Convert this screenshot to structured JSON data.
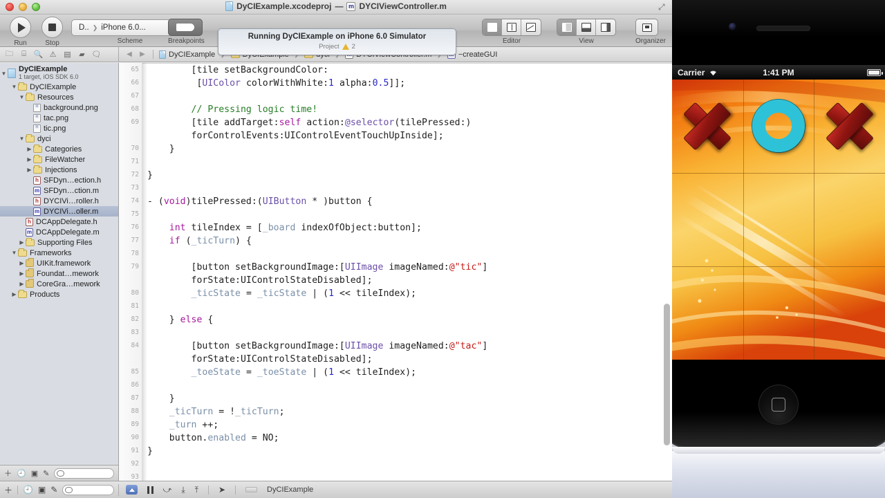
{
  "window": {
    "title_project": "DyCIExample.xcodeproj",
    "title_sep": "—",
    "title_file": "DYCIViewController.m",
    "m_badge": "m"
  },
  "toolbar": {
    "run_label": "Run",
    "stop_label": "Stop",
    "scheme_label": "Scheme",
    "scheme_target": "D..",
    "scheme_device": "iPhone 6.0...",
    "breakpoints_label": "Breakpoints",
    "activity_main": "Running DyCIExample on iPhone 6.0 Simulator",
    "activity_sub": "Project",
    "warning_count": "2",
    "editor_label": "Editor",
    "view_label": "View",
    "organizer_label": "Organizer"
  },
  "jumpbar": {
    "back": "◀",
    "forward": "▶",
    "crumbs": [
      {
        "label": "DyCIExample",
        "icon": "project-icon"
      },
      {
        "label": "DyCIExample",
        "icon": "folder-icon"
      },
      {
        "label": "dyci",
        "icon": "folder-icon"
      },
      {
        "label": "DYCIViewController.m",
        "icon": "m-file-icon"
      },
      {
        "label": "−createGUI",
        "icon": "method-icon"
      }
    ]
  },
  "navigator": {
    "selector_icons": [
      "folder-icon",
      "hierarchy-icon",
      "search-icon",
      "warning-icon",
      "test-icon",
      "breakpoint-icon",
      "log-icon",
      "grid-icon"
    ],
    "project": {
      "name": "DyCIExample",
      "subtitle": "1 target, iOS SDK 6.0"
    },
    "items": [
      {
        "label": "DyCIExample",
        "icon": "folder-icon",
        "indent": 1,
        "disc": "open"
      },
      {
        "label": "Resources",
        "icon": "folder-icon",
        "indent": 2,
        "disc": "open"
      },
      {
        "label": "background.png",
        "icon": "image-icon",
        "indent": 3,
        "disc": "none"
      },
      {
        "label": "tac.png",
        "icon": "image-icon",
        "indent": 3,
        "disc": "none"
      },
      {
        "label": "tic.png",
        "icon": "image-icon",
        "indent": 3,
        "disc": "none"
      },
      {
        "label": "dyci",
        "icon": "folder-icon",
        "indent": 2,
        "disc": "open"
      },
      {
        "label": "Categories",
        "icon": "folder-icon",
        "indent": 3,
        "disc": "closed"
      },
      {
        "label": "FileWatcher",
        "icon": "folder-icon",
        "indent": 3,
        "disc": "closed"
      },
      {
        "label": "Injections",
        "icon": "folder-icon",
        "indent": 3,
        "disc": "closed"
      },
      {
        "label": "SFDyn…ection.h",
        "icon": "h-file-icon",
        "indent": 3,
        "disc": "none"
      },
      {
        "label": "SFDyn…ction.m",
        "icon": "m-file-icon",
        "indent": 3,
        "disc": "none"
      },
      {
        "label": "DYCIVi…roller.h",
        "icon": "h-file-icon",
        "indent": 3,
        "disc": "none"
      },
      {
        "label": "DYCIVi…oller.m",
        "icon": "m-file-icon",
        "indent": 3,
        "disc": "none",
        "selected": true
      },
      {
        "label": "DCAppDelegate.h",
        "icon": "h-file-icon",
        "indent": 2,
        "disc": "none"
      },
      {
        "label": "DCAppDelegate.m",
        "icon": "m-file-icon",
        "indent": 2,
        "disc": "none"
      },
      {
        "label": "Supporting Files",
        "icon": "folder-icon",
        "indent": 2,
        "disc": "closed"
      },
      {
        "label": "Frameworks",
        "icon": "folder-icon",
        "indent": 1,
        "disc": "open"
      },
      {
        "label": "UIKit.framework",
        "icon": "framework-icon",
        "indent": 2,
        "disc": "closed"
      },
      {
        "label": "Foundat…mework",
        "icon": "framework-icon",
        "indent": 2,
        "disc": "closed"
      },
      {
        "label": "CoreGra…mework",
        "icon": "framework-icon",
        "indent": 2,
        "disc": "closed"
      },
      {
        "label": "Products",
        "icon": "folder-icon",
        "indent": 1,
        "disc": "closed"
      }
    ],
    "filter_placeholder": ""
  },
  "editor": {
    "first_line": 65,
    "lines": [
      {
        "n": 65,
        "indent": 4,
        "tokens": [
          {
            "t": "[tile setBackgroundColor:",
            "c": ""
          }
        ]
      },
      {
        "n": 66,
        "indent": 4.5,
        "tokens": [
          {
            "t": "[",
            "c": ""
          },
          {
            "t": "UIColor",
            "c": "cls"
          },
          {
            "t": " colorWithWhite:",
            "c": ""
          },
          {
            "t": "1",
            "c": "num"
          },
          {
            "t": " alpha:",
            "c": ""
          },
          {
            "t": "0.5",
            "c": "num"
          },
          {
            "t": "]];",
            "c": ""
          }
        ]
      },
      {
        "n": 67,
        "indent": 0,
        "tokens": []
      },
      {
        "n": 68,
        "indent": 4,
        "tokens": [
          {
            "t": "// Pressing logic time!",
            "c": "cmt"
          }
        ]
      },
      {
        "n": 69,
        "indent": 4,
        "tokens": [
          {
            "t": "[tile addTarget:",
            "c": ""
          },
          {
            "t": "self",
            "c": "kw"
          },
          {
            "t": " action:",
            "c": ""
          },
          {
            "t": "@selector",
            "c": "pre"
          },
          {
            "t": "(tilePressed:)",
            "c": ""
          }
        ]
      },
      {
        "n": null,
        "indent": 4,
        "tokens": [
          {
            "t": "forControlEvents:UIControlEventTouchUpInside];",
            "c": ""
          }
        ]
      },
      {
        "n": 70,
        "indent": 2,
        "tokens": [
          {
            "t": "}",
            "c": ""
          }
        ]
      },
      {
        "n": 71,
        "indent": 0,
        "tokens": []
      },
      {
        "n": 72,
        "indent": 0,
        "tokens": [
          {
            "t": "}",
            "c": ""
          }
        ]
      },
      {
        "n": 73,
        "indent": 0,
        "tokens": []
      },
      {
        "n": 74,
        "indent": 0,
        "tokens": [
          {
            "t": "- (",
            "c": ""
          },
          {
            "t": "void",
            "c": "kw"
          },
          {
            "t": ")tilePressed:(",
            "c": ""
          },
          {
            "t": "UIButton",
            "c": "cls"
          },
          {
            "t": " * )button {",
            "c": ""
          }
        ]
      },
      {
        "n": 75,
        "indent": 0,
        "tokens": []
      },
      {
        "n": 76,
        "indent": 2,
        "tokens": [
          {
            "t": "int",
            "c": "kw"
          },
          {
            "t": " tileIndex = [",
            "c": ""
          },
          {
            "t": "_board",
            "c": "ivar"
          },
          {
            "t": " indexOfObject:button];",
            "c": ""
          }
        ]
      },
      {
        "n": 77,
        "indent": 2,
        "tokens": [
          {
            "t": "if",
            "c": "kw"
          },
          {
            "t": " (",
            "c": ""
          },
          {
            "t": "_ticTurn",
            "c": "ivar"
          },
          {
            "t": ") {",
            "c": ""
          }
        ]
      },
      {
        "n": 78,
        "indent": 0,
        "tokens": []
      },
      {
        "n": 79,
        "indent": 4,
        "tokens": [
          {
            "t": "[button setBackgroundImage:[",
            "c": ""
          },
          {
            "t": "UIImage",
            "c": "cls"
          },
          {
            "t": " imageNamed:",
            "c": ""
          },
          {
            "t": "@\"tic\"",
            "c": "str"
          },
          {
            "t": "]",
            "c": ""
          }
        ]
      },
      {
        "n": null,
        "indent": 4,
        "tokens": [
          {
            "t": "forState:UIControlStateDisabled];",
            "c": ""
          }
        ]
      },
      {
        "n": 80,
        "indent": 4,
        "tokens": [
          {
            "t": "_ticState",
            "c": "ivar"
          },
          {
            "t": " = ",
            "c": ""
          },
          {
            "t": "_ticState",
            "c": "ivar"
          },
          {
            "t": " | (",
            "c": ""
          },
          {
            "t": "1",
            "c": "num"
          },
          {
            "t": " << tileIndex);",
            "c": ""
          }
        ]
      },
      {
        "n": 81,
        "indent": 0,
        "tokens": []
      },
      {
        "n": 82,
        "indent": 2,
        "tokens": [
          {
            "t": "} ",
            "c": ""
          },
          {
            "t": "else",
            "c": "kw"
          },
          {
            "t": " {",
            "c": ""
          }
        ]
      },
      {
        "n": 83,
        "indent": 0,
        "tokens": []
      },
      {
        "n": 84,
        "indent": 4,
        "tokens": [
          {
            "t": "[button setBackgroundImage:[",
            "c": ""
          },
          {
            "t": "UIImage",
            "c": "cls"
          },
          {
            "t": " imageNamed:",
            "c": ""
          },
          {
            "t": "@\"tac\"",
            "c": "str"
          },
          {
            "t": "]",
            "c": ""
          }
        ]
      },
      {
        "n": null,
        "indent": 4,
        "tokens": [
          {
            "t": "forState:UIControlStateDisabled];",
            "c": ""
          }
        ]
      },
      {
        "n": 85,
        "indent": 4,
        "tokens": [
          {
            "t": "_toeState",
            "c": "ivar"
          },
          {
            "t": " = ",
            "c": ""
          },
          {
            "t": "_toeState",
            "c": "ivar"
          },
          {
            "t": " | (",
            "c": ""
          },
          {
            "t": "1",
            "c": "num"
          },
          {
            "t": " << tileIndex);",
            "c": ""
          }
        ]
      },
      {
        "n": 86,
        "indent": 0,
        "tokens": []
      },
      {
        "n": 87,
        "indent": 2,
        "tokens": [
          {
            "t": "}",
            "c": ""
          }
        ]
      },
      {
        "n": 88,
        "indent": 2,
        "tokens": [
          {
            "t": "_ticTurn",
            "c": "ivar"
          },
          {
            "t": " = !",
            "c": ""
          },
          {
            "t": "_ticTurn",
            "c": "ivar"
          },
          {
            "t": ";",
            "c": ""
          }
        ]
      },
      {
        "n": 89,
        "indent": 2,
        "tokens": [
          {
            "t": "_turn",
            "c": "ivar"
          },
          {
            "t": " ++;",
            "c": ""
          }
        ]
      },
      {
        "n": 90,
        "indent": 2,
        "tokens": [
          {
            "t": "button.",
            "c": ""
          },
          {
            "t": "enabled",
            "c": "ivar"
          },
          {
            "t": " = NO;",
            "c": ""
          }
        ]
      },
      {
        "n": 91,
        "indent": 0,
        "tokens": [
          {
            "t": "}",
            "c": ""
          }
        ]
      },
      {
        "n": 92,
        "indent": 0,
        "tokens": []
      },
      {
        "n": 93,
        "indent": 0,
        "tokens": []
      }
    ],
    "colors": {
      "keyword": "#a41a9c",
      "class": "#6b4fa8",
      "number": "#2727c8",
      "string": "#c41a16",
      "comment": "#267d26",
      "ivar": "#7a8fa8",
      "plain": "#1f1f1f"
    }
  },
  "statusbar": {
    "scheme_name": "DyCIExample",
    "icons": [
      "add-icon",
      "history-icon",
      "snapshot-icon",
      "edit-icon",
      "debug-toggle-icon",
      "pause-icon",
      "step-over-icon",
      "step-into-icon",
      "step-out-icon",
      "location-icon"
    ]
  },
  "simulator": {
    "carrier": "Carrier",
    "time": "1:41 PM",
    "board": [
      [
        "X",
        "O",
        "X"
      ],
      [
        "",
        "",
        ""
      ],
      [
        "",
        "",
        ""
      ]
    ],
    "colors": {
      "x_mark": "#8e1511",
      "o_mark": "#2ec2d8",
      "background_warm": "#f5a623"
    }
  }
}
